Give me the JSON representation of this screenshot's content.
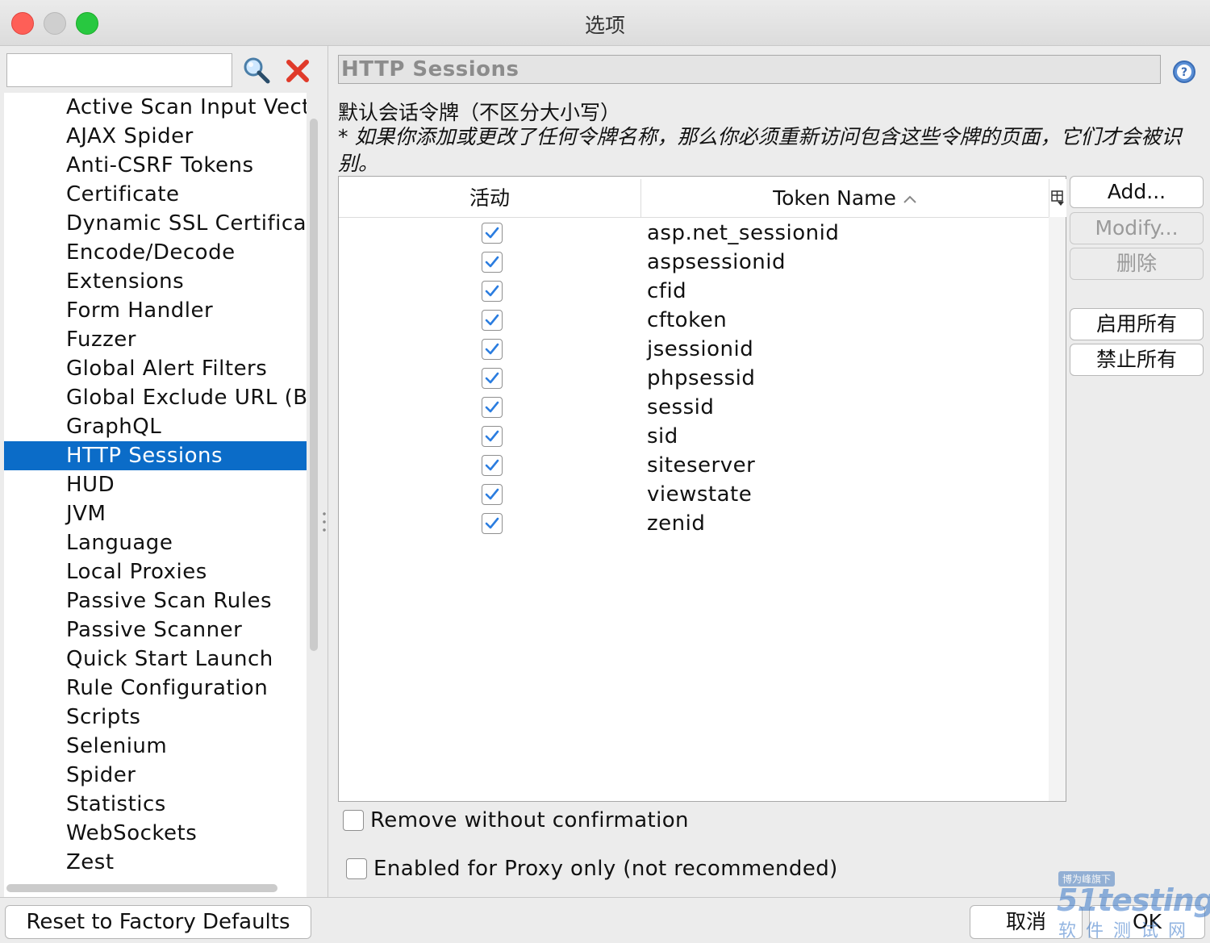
{
  "window": {
    "title": "选项"
  },
  "search": {
    "value": "",
    "placeholder": ""
  },
  "tree": {
    "items": [
      "Active Scan Input Vectors",
      "AJAX Spider",
      "Anti-CSRF Tokens",
      "Certificate",
      "Dynamic SSL Certificates",
      "Encode/Decode",
      "Extensions",
      "Form Handler",
      "Fuzzer",
      "Global Alert Filters",
      "Global Exclude URL (Beta)",
      "GraphQL",
      "HTTP Sessions",
      "HUD",
      "JVM",
      "Language",
      "Local Proxies",
      "Passive Scan Rules",
      "Passive Scanner",
      "Quick Start Launch",
      "Rule Configuration",
      "Scripts",
      "Selenium",
      "Spider",
      "Statistics",
      "WebSockets",
      "Zest"
    ],
    "selected": "HTTP Sessions"
  },
  "panel": {
    "title": "HTTP Sessions",
    "desc_line1": "默认会话令牌（不区分大小写）",
    "desc_line2": "* 如果你添加或更改了任何令牌名称，那么你必须重新访问包含这些令牌的页面，它们才会被识别。"
  },
  "table": {
    "columns": {
      "active": "活动",
      "name": "Token Name"
    },
    "rows": [
      {
        "active": true,
        "name": "asp.net_sessionid"
      },
      {
        "active": true,
        "name": "aspsessionid"
      },
      {
        "active": true,
        "name": "cfid"
      },
      {
        "active": true,
        "name": "cftoken"
      },
      {
        "active": true,
        "name": "jsessionid"
      },
      {
        "active": true,
        "name": "phpsessid"
      },
      {
        "active": true,
        "name": "sessid"
      },
      {
        "active": true,
        "name": "sid"
      },
      {
        "active": true,
        "name": "siteserver"
      },
      {
        "active": true,
        "name": "viewstate"
      },
      {
        "active": true,
        "name": "zenid"
      }
    ]
  },
  "buttons": {
    "add": "Add...",
    "modify": "Modify...",
    "delete": "删除",
    "enable_all": "启用所有",
    "disable_all": "禁止所有",
    "reset": "Reset to Factory Defaults",
    "cancel": "取消",
    "ok": "OK"
  },
  "options": {
    "remove_without_confirmation": {
      "label": "Remove without confirmation",
      "checked": false
    },
    "proxy_only": {
      "label": "Enabled for Proxy only (not recommended)",
      "checked": false
    }
  },
  "watermark": {
    "badge": "博为峰旗下",
    "logo": "51testing",
    "sub": "软件测试网"
  },
  "colors": {
    "selection": "#0b6cc8",
    "check": "#2b7de0"
  }
}
